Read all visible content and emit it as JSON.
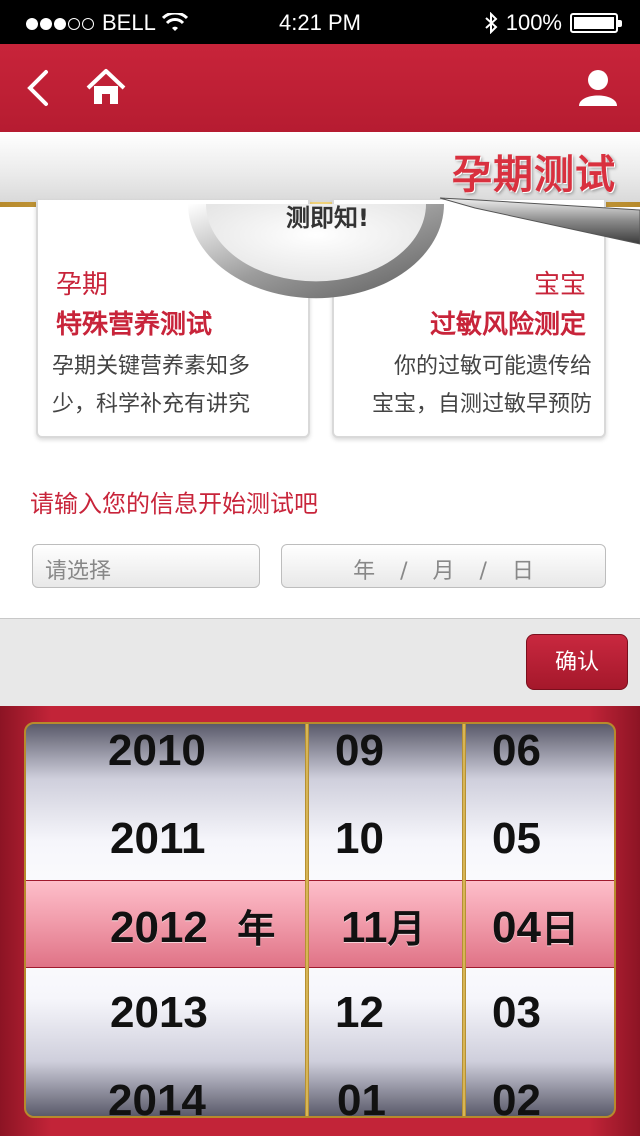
{
  "status_bar": {
    "carrier": "BELL",
    "time": "4:21 PM",
    "battery": "100%",
    "battery_level": 1.0
  },
  "nav": {
    "icons": [
      "back-arrow-icon",
      "home-icon",
      "user-icon"
    ]
  },
  "banner": {
    "title": "孕期测试",
    "magnifier_text": "测即知!"
  },
  "cards": [
    {
      "kicker": "孕期",
      "title": "特殊营养测试",
      "desc_line1": "孕期关键营养素知多",
      "desc_line2": "少，科学补充有讲究"
    },
    {
      "kicker": "宝宝",
      "title": "过敏风险测定",
      "desc_line1": "你的过敏可能遗传给",
      "desc_line2": "宝宝，自测过敏早预防"
    }
  ],
  "form": {
    "prompt": "请输入您的信息开始测试吧",
    "select_placeholder": "请选择",
    "date_placeholder": "年 / 月 / 日"
  },
  "picker": {
    "confirm_label": "确认",
    "years": [
      "2010",
      "2011",
      "2012",
      "2013",
      "2014"
    ],
    "months": [
      "09",
      "10",
      "11",
      "12",
      "01"
    ],
    "days": [
      "06",
      "05",
      "04",
      "03",
      "02"
    ],
    "selected_year": "2012",
    "selected_month": "11",
    "selected_day": "04",
    "year_unit": "年",
    "month_unit": "月",
    "day_unit": "日"
  },
  "colors": {
    "brand_red": "#c8243a",
    "gold_accent": "#d4a640"
  }
}
